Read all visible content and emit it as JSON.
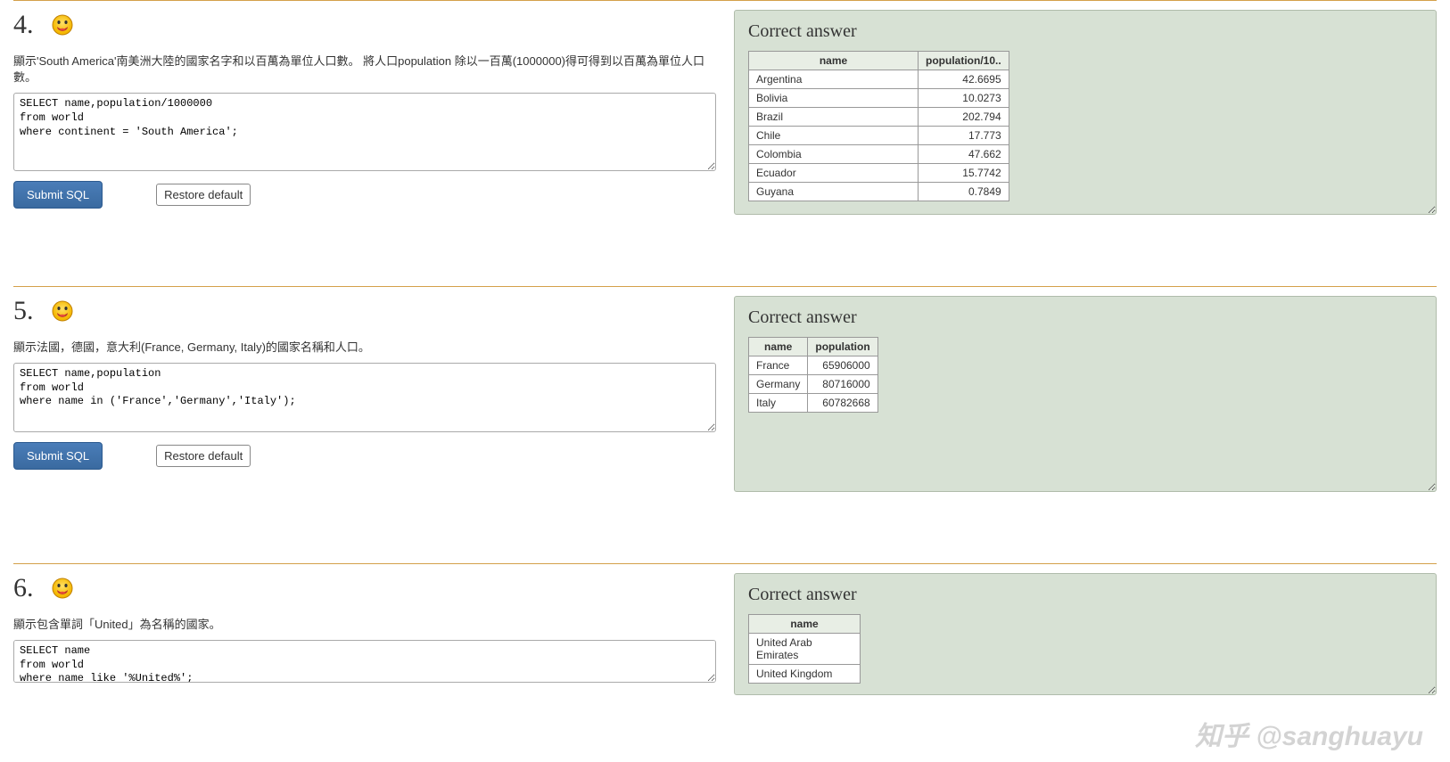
{
  "watermark": "知乎 @sanghuayu",
  "buttons": {
    "submit": "Submit SQL",
    "restore": "Restore default"
  },
  "answer_title": "Correct answer",
  "questions": [
    {
      "num": "4.",
      "desc": "顯示'South America'南美洲大陸的國家名字和以百萬為單位人口數。 將人口population 除以一百萬(1000000)得可得到以百萬為單位人口數。",
      "sql": "SELECT name,population/1000000\nfrom world\nwhere continent = 'South America';",
      "table": {
        "headers": [
          "name",
          "population/10.."
        ],
        "rows": [
          [
            "Argentina",
            "42.6695"
          ],
          [
            "Bolivia",
            "10.0273"
          ],
          [
            "Brazil",
            "202.794"
          ],
          [
            "Chile",
            "17.773"
          ],
          [
            "Colombia",
            "47.662"
          ],
          [
            "Ecuador",
            "15.7742"
          ],
          [
            "Guyana",
            "0.7849"
          ]
        ],
        "col_widths": [
          "190px",
          "100px"
        ],
        "scroll": true
      }
    },
    {
      "num": "5.",
      "desc": "顯示法國，德國，意大利(France, Germany, Italy)的國家名稱和人口。",
      "sql": "SELECT name,population\nfrom world\nwhere name in ('France','Germany','Italy');",
      "table": {
        "headers": [
          "name",
          "population"
        ],
        "rows": [
          [
            "France",
            "65906000"
          ],
          [
            "Germany",
            "80716000"
          ],
          [
            "Italy",
            "60782668"
          ]
        ],
        "col_widths": [
          "60px",
          "75px"
        ],
        "scroll": false
      }
    },
    {
      "num": "6.",
      "desc": "顯示包含單詞「United」為名稱的國家。",
      "sql": "SELECT name\nfrom world\nwhere name like '%United%';",
      "table": {
        "headers": [
          "name"
        ],
        "rows": [
          [
            "United Arab Emirates"
          ],
          [
            "United Kingdom"
          ]
        ],
        "col_widths": [
          "125px"
        ],
        "scroll": false
      }
    }
  ]
}
